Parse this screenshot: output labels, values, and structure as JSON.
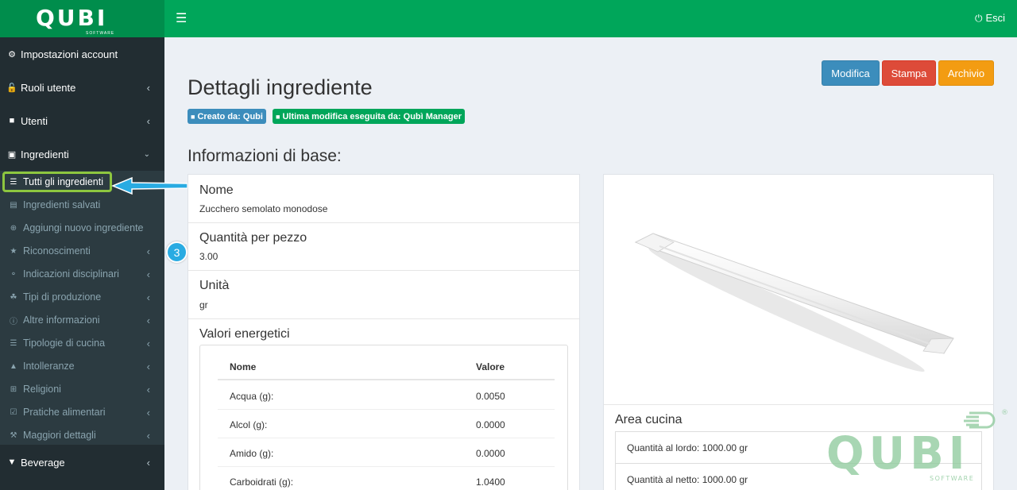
{
  "brand": {
    "name": "QUBI",
    "sub": "SOFTWARE"
  },
  "topbar": {
    "logout_label": "Esci"
  },
  "sidebar": {
    "items": [
      {
        "label": "Impostazioni account",
        "icon": "gear-icon"
      },
      {
        "label": "Ruoli utente",
        "icon": "unlock-icon"
      },
      {
        "label": "Utenti",
        "icon": "user-icon"
      },
      {
        "label": "Ingredienti",
        "icon": "puzzle-icon"
      }
    ],
    "submenu": [
      {
        "label": "Tutti gli ingredienti",
        "icon": "list-icon"
      },
      {
        "label": "Ingredienti salvati",
        "icon": "archive-icon"
      },
      {
        "label": "Aggiungi nuovo ingrediente",
        "icon": "plus-circle-icon"
      },
      {
        "label": "Riconoscimenti",
        "icon": "trophy-icon"
      },
      {
        "label": "Indicazioni disciplinari",
        "icon": "lightbulb-icon"
      },
      {
        "label": "Tipi di produzione",
        "icon": "leaf-icon"
      },
      {
        "label": "Altre informazioni",
        "icon": "info-icon"
      },
      {
        "label": "Tipologie di cucina",
        "icon": "list-icon"
      },
      {
        "label": "Intolleranze",
        "icon": "warning-icon"
      },
      {
        "label": "Religioni",
        "icon": "plus-square-icon"
      },
      {
        "label": "Pratiche alimentari",
        "icon": "check-square-icon"
      },
      {
        "label": "Maggiori dettagli",
        "icon": "wrench-icon"
      }
    ],
    "bottom_item": {
      "label": "Beverage",
      "icon": "glass-icon"
    }
  },
  "callout": {
    "step": "3"
  },
  "page": {
    "title": "Dettagli ingrediente",
    "created_by": "Creato da: Qubi",
    "modified_by": "Ultima modifica eseguita da: Qubì Manager"
  },
  "actions": {
    "edit": "Modifica",
    "print": "Stampa",
    "archive": "Archivio"
  },
  "section_title": "Informazioni di base:",
  "info": {
    "name_label": "Nome",
    "name_value": "Zucchero semolato monodose",
    "qty_label": "Quantità per pezzo",
    "qty_value": "3.00",
    "unit_label": "Unità",
    "unit_value": "gr",
    "energy_label": "Valori energetici"
  },
  "energy_table": {
    "headers": [
      "Nome",
      "Valore"
    ],
    "rows": [
      [
        "Acqua (g):",
        "0.0050"
      ],
      [
        "Alcol (g):",
        "0.0000"
      ],
      [
        "Amido (g):",
        "0.0000"
      ],
      [
        "Carboidrati (g):",
        "1.0400"
      ]
    ]
  },
  "kitchen": {
    "title": "Area cucina",
    "gross": "Quantità al lordo: 1000.00 gr",
    "net": "Quantità al netto: 1000.00 gr"
  },
  "colors": {
    "topbar": "#00a65a",
    "sidebar": "#222d32",
    "accent": "#8dc63f"
  }
}
